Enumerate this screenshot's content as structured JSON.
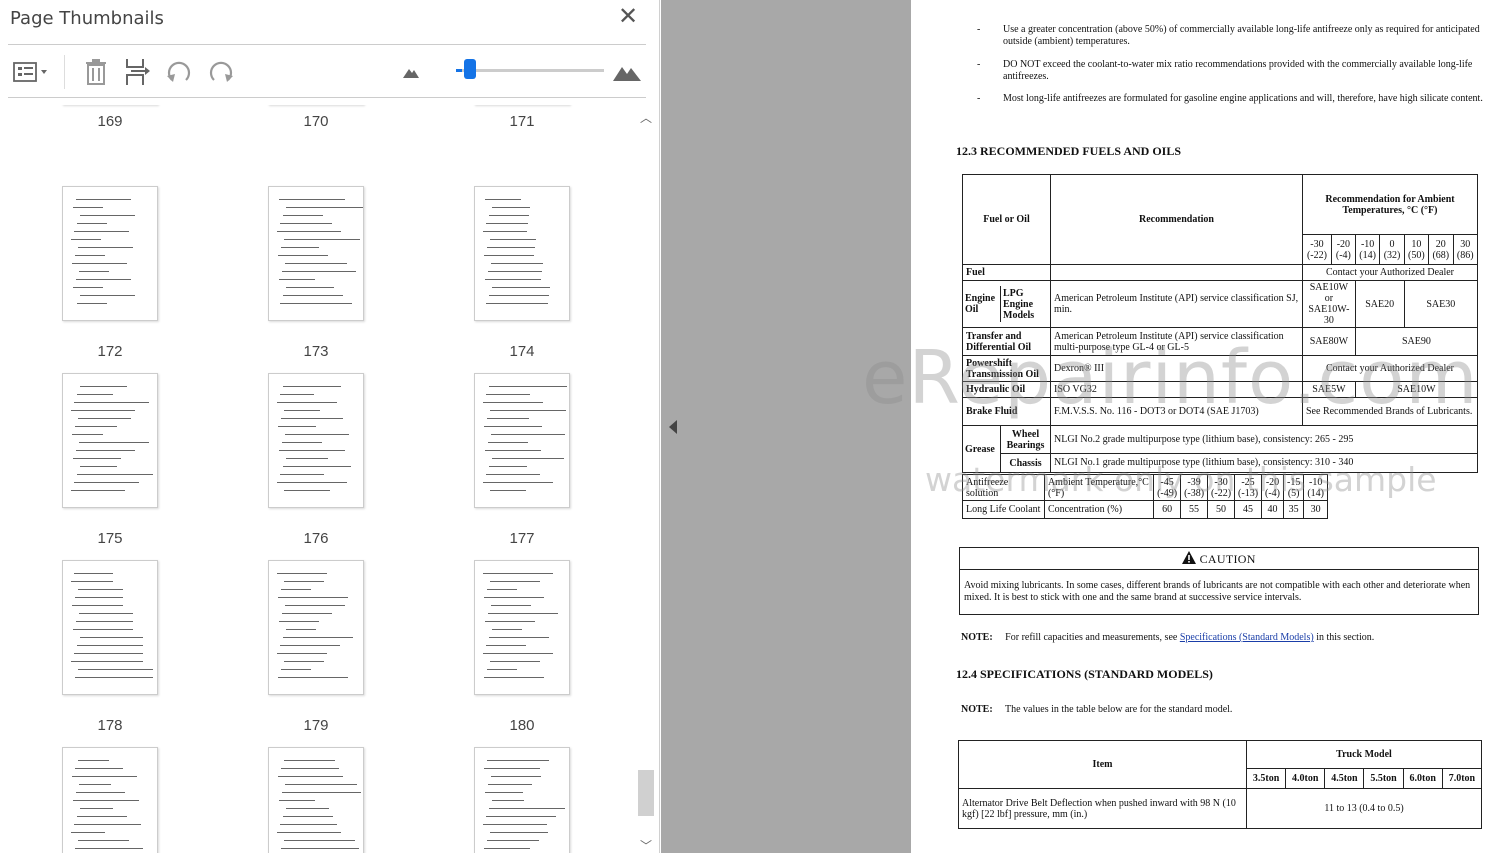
{
  "panel": {
    "title": "Page Thumbnails",
    "close_label": "✕",
    "zoom_level": 0.04,
    "thumbnails": [
      {
        "page": "169"
      },
      {
        "page": "170"
      },
      {
        "page": "171"
      },
      {
        "page": "172"
      },
      {
        "page": "173"
      },
      {
        "page": "174"
      },
      {
        "page": "175"
      },
      {
        "page": "176"
      },
      {
        "page": "177"
      },
      {
        "page": "178"
      },
      {
        "page": "179"
      },
      {
        "page": "180"
      },
      {
        "page": ""
      },
      {
        "page": ""
      },
      {
        "page": ""
      }
    ]
  },
  "doc": {
    "bullets": [
      "Use a greater concentration (above 50%) of commercially available long-life antifreeze only as required for anticipated outside (ambient) temperatures.",
      "DO NOT exceed the coolant-to-water mix ratio recommendations provided with the commercially available long-life antifreezes.",
      "Most long-life antifreezes are formulated for gasoline engine applications and will, therefore, have high silicate content."
    ],
    "bullet_mark": "-",
    "section_12_3": "12.3  RECOMMENDED FUELS AND OILS",
    "fuels_table": {
      "h_fuel": "Fuel or Oil",
      "h_rec": "Recommendation",
      "h_ambient": "Recommendation for Ambient Temperatures, °C (°F)",
      "temps": [
        "-30 (-22)",
        "-20 (-4)",
        "-10 (14)",
        "0 (32)",
        "10 (50)",
        "20 (68)",
        "30 (86)"
      ],
      "fuel": "Fuel",
      "fuel_dealer": "Contact your Authorized Dealer",
      "engine_oil": "Engine Oil",
      "lpg": "LPG Engine Models",
      "engine_rec": "American Petroleum Institute (API) service classification SJ, min.",
      "engine_v1": "SAE10W or SAE10W-30",
      "engine_v2": "SAE20",
      "engine_v3": "SAE30",
      "transfer": "Transfer and Differential Oil",
      "transfer_rec": "American Petroleum Institute (API) service classification multi-purpose type GL-4 or GL-5",
      "transfer_v1": "SAE80W",
      "transfer_v2": "SAE90",
      "powershift": "Powershift Transmission Oil",
      "powershift_rec": "Dexron® III",
      "powershift_v": "Contact your Authorized Dealer",
      "hydraulic": "Hydraulic Oil",
      "hydraulic_rec": "ISO VG32",
      "hydraulic_v1": "SAE5W",
      "hydraulic_v2": "SAE10W",
      "brake": "Brake Fluid",
      "brake_rec": "F.M.V.S.S. No. 116 - DOT3 or DOT4 (SAE J1703)",
      "brake_v": "See Recommended Brands of Lubricants.",
      "grease": "Grease",
      "wheel": "Wheel Bearings",
      "wheel_rec": "NLGI No.2 grade multipurpose type (lithium base), consistency: 265 - 295",
      "chassis": "Chassis",
      "chassis_rec": "NLGI No.1 grade multipurpose type (lithium base), consistency: 310 - 340"
    },
    "antifreeze_table": {
      "label1": "Antifreeze solution",
      "label2": "Ambient Temperature,°C (°F)",
      "temps": [
        "-45 (-49)",
        "-39 (-38)",
        "-30 (-22)",
        "-25 (-13)",
        "-20 (-4)",
        "-15 (5)",
        "-10 (14)"
      ],
      "label3": "Long Life Coolant",
      "label4": "Concentration (%)",
      "values": [
        "60",
        "55",
        "50",
        "45",
        "40",
        "35",
        "30"
      ]
    },
    "caution": {
      "title": "CAUTION",
      "body": "Avoid mixing lubricants. In some cases, different brands of lubricants are not compatible with each other and deteriorate when mixed. It is best to stick with one and the same brand at successive service intervals."
    },
    "note1": {
      "label": "NOTE:",
      "text": "For refill capacities and measurements, see",
      "link": "Specifications (Standard Models)",
      "tail": "in this section."
    },
    "section_12_4": "12.4  SPECIFICATIONS (STANDARD MODELS)",
    "note2": {
      "label": "NOTE:",
      "text": "The values in the table below are for the standard model."
    },
    "spec_table": {
      "h_item": "Item",
      "h_truck": "Truck Model",
      "models": [
        "3.5ton",
        "4.0ton",
        "4.5ton",
        "5.5ton",
        "6.0ton",
        "7.0ton"
      ],
      "row1_item": "Alternator Drive Belt Deflection when pushed inward with 98 N (10 kgf) [22 lbf] pressure, mm (in.)",
      "row1_value": "11 to 13 (0.4 to 0.5)"
    }
  },
  "watermark": {
    "line1": "eRepairinfo.com",
    "line2": "watermark only on this sample"
  }
}
